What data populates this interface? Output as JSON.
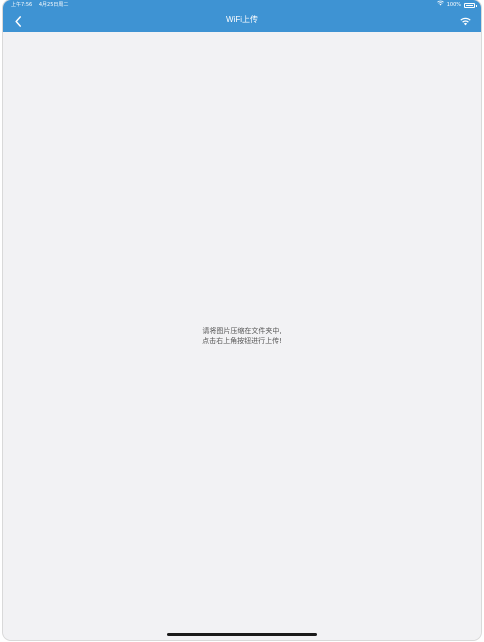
{
  "status_bar": {
    "time": "上午7:56",
    "date": "4月25日周二",
    "battery_text": "100%",
    "battery_level": 1.0,
    "wifi_icon": "wifi-icon"
  },
  "nav_bar": {
    "title": "WiFi上传",
    "back_icon": "chevron-left-icon",
    "upload_icon": "wifi-icon"
  },
  "content": {
    "hint_line1": "请将图片压缩在文件夹中,",
    "hint_line2": "点击右上角按钮进行上传!"
  },
  "colors": {
    "nav_background": "#3e93d3",
    "content_background": "#f2f2f4",
    "hint_text": "#555555"
  }
}
